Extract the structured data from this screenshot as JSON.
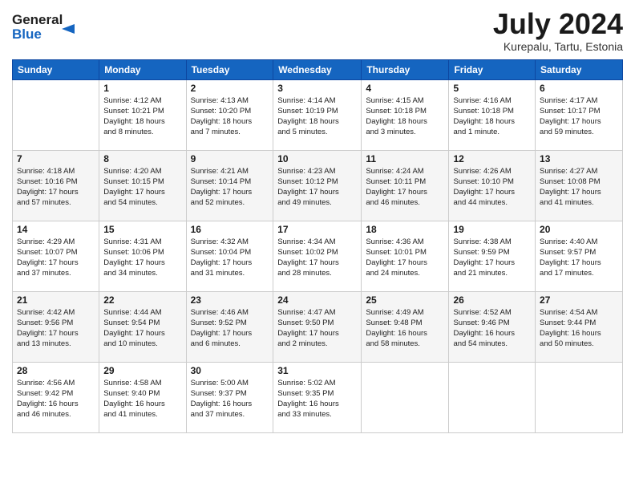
{
  "logo": {
    "line1": "General",
    "line2": "Blue"
  },
  "header": {
    "month_year": "July 2024",
    "location": "Kurepalu, Tartu, Estonia"
  },
  "days_of_week": [
    "Sunday",
    "Monday",
    "Tuesday",
    "Wednesday",
    "Thursday",
    "Friday",
    "Saturday"
  ],
  "weeks": [
    [
      {
        "day": "",
        "info": ""
      },
      {
        "day": "1",
        "info": "Sunrise: 4:12 AM\nSunset: 10:21 PM\nDaylight: 18 hours\nand 8 minutes."
      },
      {
        "day": "2",
        "info": "Sunrise: 4:13 AM\nSunset: 10:20 PM\nDaylight: 18 hours\nand 7 minutes."
      },
      {
        "day": "3",
        "info": "Sunrise: 4:14 AM\nSunset: 10:19 PM\nDaylight: 18 hours\nand 5 minutes."
      },
      {
        "day": "4",
        "info": "Sunrise: 4:15 AM\nSunset: 10:18 PM\nDaylight: 18 hours\nand 3 minutes."
      },
      {
        "day": "5",
        "info": "Sunrise: 4:16 AM\nSunset: 10:18 PM\nDaylight: 18 hours\nand 1 minute."
      },
      {
        "day": "6",
        "info": "Sunrise: 4:17 AM\nSunset: 10:17 PM\nDaylight: 17 hours\nand 59 minutes."
      }
    ],
    [
      {
        "day": "7",
        "info": "Sunrise: 4:18 AM\nSunset: 10:16 PM\nDaylight: 17 hours\nand 57 minutes."
      },
      {
        "day": "8",
        "info": "Sunrise: 4:20 AM\nSunset: 10:15 PM\nDaylight: 17 hours\nand 54 minutes."
      },
      {
        "day": "9",
        "info": "Sunrise: 4:21 AM\nSunset: 10:14 PM\nDaylight: 17 hours\nand 52 minutes."
      },
      {
        "day": "10",
        "info": "Sunrise: 4:23 AM\nSunset: 10:12 PM\nDaylight: 17 hours\nand 49 minutes."
      },
      {
        "day": "11",
        "info": "Sunrise: 4:24 AM\nSunset: 10:11 PM\nDaylight: 17 hours\nand 46 minutes."
      },
      {
        "day": "12",
        "info": "Sunrise: 4:26 AM\nSunset: 10:10 PM\nDaylight: 17 hours\nand 44 minutes."
      },
      {
        "day": "13",
        "info": "Sunrise: 4:27 AM\nSunset: 10:08 PM\nDaylight: 17 hours\nand 41 minutes."
      }
    ],
    [
      {
        "day": "14",
        "info": "Sunrise: 4:29 AM\nSunset: 10:07 PM\nDaylight: 17 hours\nand 37 minutes."
      },
      {
        "day": "15",
        "info": "Sunrise: 4:31 AM\nSunset: 10:06 PM\nDaylight: 17 hours\nand 34 minutes."
      },
      {
        "day": "16",
        "info": "Sunrise: 4:32 AM\nSunset: 10:04 PM\nDaylight: 17 hours\nand 31 minutes."
      },
      {
        "day": "17",
        "info": "Sunrise: 4:34 AM\nSunset: 10:02 PM\nDaylight: 17 hours\nand 28 minutes."
      },
      {
        "day": "18",
        "info": "Sunrise: 4:36 AM\nSunset: 10:01 PM\nDaylight: 17 hours\nand 24 minutes."
      },
      {
        "day": "19",
        "info": "Sunrise: 4:38 AM\nSunset: 9:59 PM\nDaylight: 17 hours\nand 21 minutes."
      },
      {
        "day": "20",
        "info": "Sunrise: 4:40 AM\nSunset: 9:57 PM\nDaylight: 17 hours\nand 17 minutes."
      }
    ],
    [
      {
        "day": "21",
        "info": "Sunrise: 4:42 AM\nSunset: 9:56 PM\nDaylight: 17 hours\nand 13 minutes."
      },
      {
        "day": "22",
        "info": "Sunrise: 4:44 AM\nSunset: 9:54 PM\nDaylight: 17 hours\nand 10 minutes."
      },
      {
        "day": "23",
        "info": "Sunrise: 4:46 AM\nSunset: 9:52 PM\nDaylight: 17 hours\nand 6 minutes."
      },
      {
        "day": "24",
        "info": "Sunrise: 4:47 AM\nSunset: 9:50 PM\nDaylight: 17 hours\nand 2 minutes."
      },
      {
        "day": "25",
        "info": "Sunrise: 4:49 AM\nSunset: 9:48 PM\nDaylight: 16 hours\nand 58 minutes."
      },
      {
        "day": "26",
        "info": "Sunrise: 4:52 AM\nSunset: 9:46 PM\nDaylight: 16 hours\nand 54 minutes."
      },
      {
        "day": "27",
        "info": "Sunrise: 4:54 AM\nSunset: 9:44 PM\nDaylight: 16 hours\nand 50 minutes."
      }
    ],
    [
      {
        "day": "28",
        "info": "Sunrise: 4:56 AM\nSunset: 9:42 PM\nDaylight: 16 hours\nand 46 minutes."
      },
      {
        "day": "29",
        "info": "Sunrise: 4:58 AM\nSunset: 9:40 PM\nDaylight: 16 hours\nand 41 minutes."
      },
      {
        "day": "30",
        "info": "Sunrise: 5:00 AM\nSunset: 9:37 PM\nDaylight: 16 hours\nand 37 minutes."
      },
      {
        "day": "31",
        "info": "Sunrise: 5:02 AM\nSunset: 9:35 PM\nDaylight: 16 hours\nand 33 minutes."
      },
      {
        "day": "",
        "info": ""
      },
      {
        "day": "",
        "info": ""
      },
      {
        "day": "",
        "info": ""
      }
    ]
  ]
}
